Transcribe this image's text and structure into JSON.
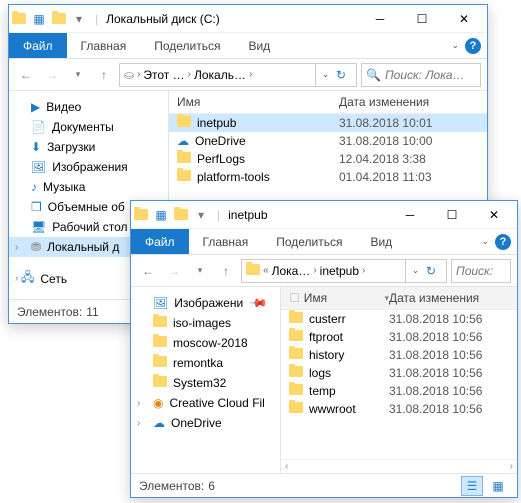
{
  "win1": {
    "title": "Локальный диск (C:)",
    "ribbon": {
      "file": "Файл",
      "tabs": [
        "Главная",
        "Поделиться",
        "Вид"
      ]
    },
    "path": {
      "parts": [
        "Этот …",
        "Локаль…"
      ]
    },
    "search_placeholder": "Поиск: Лока…",
    "nav": [
      {
        "icon": "video",
        "label": "Видео"
      },
      {
        "icon": "doc",
        "label": "Документы"
      },
      {
        "icon": "download",
        "label": "Загрузки"
      },
      {
        "icon": "image",
        "label": "Изображения"
      },
      {
        "icon": "music",
        "label": "Музыка"
      },
      {
        "icon": "cube",
        "label": "Объемные об"
      },
      {
        "icon": "desktop",
        "label": "Рабочий стол"
      },
      {
        "icon": "disk",
        "label": "Локальный д",
        "selected": true,
        "expandable": true
      },
      {
        "icon": "network",
        "label": "Сеть",
        "indent": true,
        "expandable": true
      }
    ],
    "columns": {
      "name": "Имя",
      "date": "Дата изменения"
    },
    "files": [
      {
        "icon": "folder",
        "name": "inetpub",
        "date": "31.08.2018 10:01",
        "selected": true
      },
      {
        "icon": "onedrive",
        "name": "OneDrive",
        "date": "31.08.2018 10:00"
      },
      {
        "icon": "folder",
        "name": "PerfLogs",
        "date": "12.04.2018 3:38"
      },
      {
        "icon": "folder",
        "name": "platform-tools",
        "date": "01.04.2018 11:03"
      }
    ],
    "status_label": "Элементов:",
    "status_count": "11"
  },
  "win2": {
    "title": "inetpub",
    "ribbon": {
      "file": "Файл",
      "tabs": [
        "Главная",
        "Поделиться",
        "Вид"
      ]
    },
    "path": {
      "parts": [
        "Лока…",
        "inetpub"
      ]
    },
    "search_placeholder": "Поиск:",
    "nav": [
      {
        "icon": "image",
        "label": "Изображени",
        "pinned": true
      },
      {
        "icon": "folder",
        "label": "iso-images"
      },
      {
        "icon": "folder",
        "label": "moscow-2018"
      },
      {
        "icon": "folder",
        "label": "remontka"
      },
      {
        "icon": "folder",
        "label": "System32"
      },
      {
        "icon": "cc",
        "label": "Creative Cloud Fil",
        "expandable": true
      },
      {
        "icon": "onedrive",
        "label": "OneDrive",
        "expandable": true
      }
    ],
    "columns": {
      "name": "Имя",
      "date": "Дата изменения"
    },
    "files": [
      {
        "icon": "folder",
        "name": "custerr",
        "date": "31.08.2018 10:56"
      },
      {
        "icon": "folder",
        "name": "ftproot",
        "date": "31.08.2018 10:56"
      },
      {
        "icon": "folder",
        "name": "history",
        "date": "31.08.2018 10:56"
      },
      {
        "icon": "folder",
        "name": "logs",
        "date": "31.08.2018 10:56"
      },
      {
        "icon": "folder",
        "name": "temp",
        "date": "31.08.2018 10:56"
      },
      {
        "icon": "folder",
        "name": "wwwroot",
        "date": "31.08.2018 10:56"
      }
    ],
    "status_label": "Элементов:",
    "status_count": "6"
  }
}
